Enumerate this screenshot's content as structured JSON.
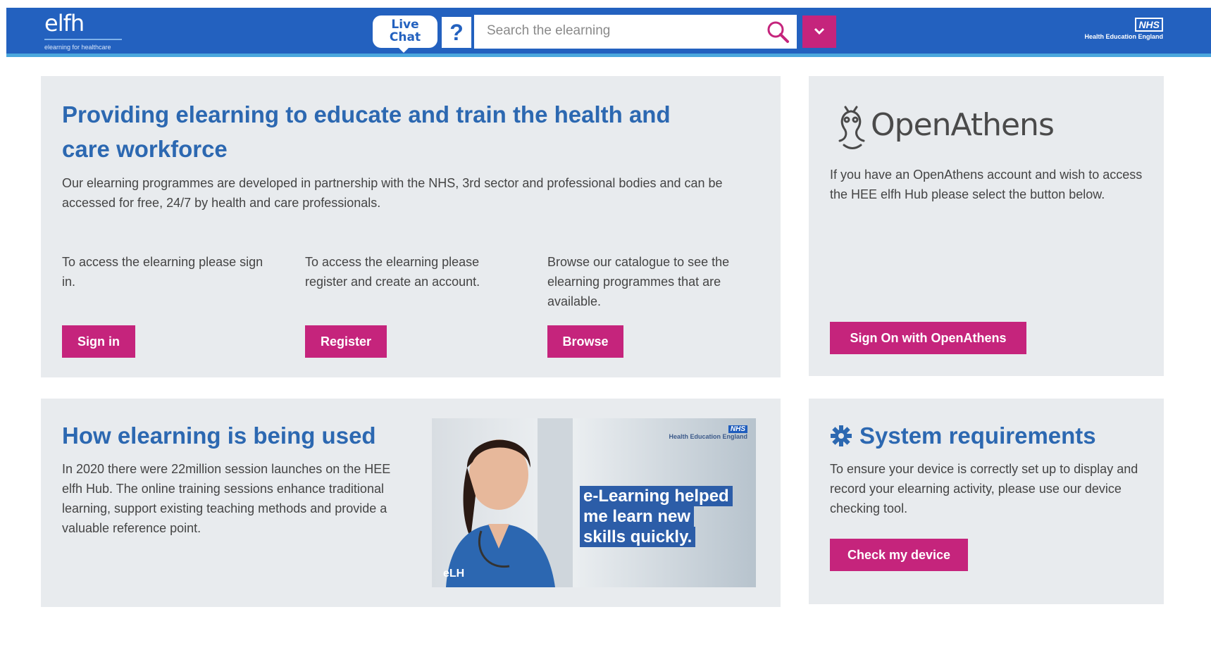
{
  "header": {
    "logo_text": "elfh",
    "logo_tagline": "elearning for healthcare",
    "live_chat_line1": "Live",
    "live_chat_line2": "Chat",
    "help_label": "?",
    "search_placeholder": "Search the elearning",
    "nhs_badge": "NHS",
    "nhs_sub": "Health Education England",
    "colors": {
      "header_bg": "#2361bf",
      "accent": "#c5247c",
      "stripe": "#4ba7dd"
    }
  },
  "intro_panel": {
    "headline": "Providing elearning to educate and train the health and care workforce",
    "description": "Our elearning programmes are developed in partnership with the NHS, 3rd sector and professional bodies and can be accessed for free, 24/7 by health and care professionals.",
    "columns": [
      {
        "text": "To access the elearning please sign in.",
        "button": "Sign in"
      },
      {
        "text": "To access the elearning please register and create an account.",
        "button": "Register"
      },
      {
        "text": "Browse our catalogue to see the elearning programmes that are available.",
        "button": "Browse"
      }
    ]
  },
  "openathens_panel": {
    "logo_text": "OpenAthens",
    "description": "If you have an OpenAthens account and wish to access the HEE elfh Hub please select the button below.",
    "button": "Sign On with OpenAthens"
  },
  "usage_panel": {
    "title": "How elearning is being used",
    "description": "In 2020 there were 22million session launches on the HEE elfh Hub. The online training sessions enhance traditional learning, support existing teaching methods and provide a valuable reference point.",
    "promo": {
      "caption_lines": [
        "e-Learning helped",
        "me learn new",
        "skills quickly."
      ],
      "nhs_badge": "NHS",
      "nhs_sub": "Health Education England",
      "logo": "eLH"
    }
  },
  "system_panel": {
    "title": "System requirements",
    "description": "To ensure your device is correctly set up to display and record your elearning activity, please use our device checking tool.",
    "button": "Check my device"
  }
}
